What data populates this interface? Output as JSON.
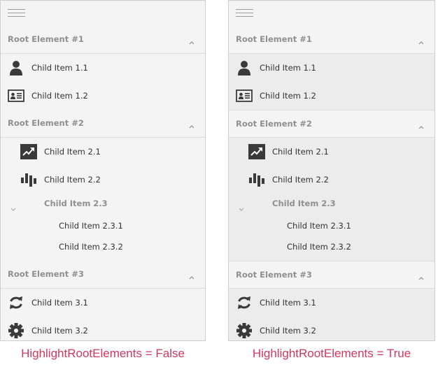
{
  "colors": {
    "panel_bg": "#f4f4f4",
    "highlight_bg": "#ececec",
    "root_text": "#8f8f8f",
    "item_text": "#333333",
    "icon": "#3a3a3a",
    "caption": "#d2385f"
  },
  "panels": [
    {
      "caption": "HighlightRootElements = False",
      "highlight_root_elements": false,
      "roots": [
        {
          "label": "Root Element #1",
          "expanded": true,
          "children": [
            {
              "label": "Child Item 1.1",
              "icon": "user-icon"
            },
            {
              "label": "Child Item 1.2",
              "icon": "id-card-icon"
            }
          ]
        },
        {
          "label": "Root Element #2",
          "expanded": true,
          "children": [
            {
              "label": "Child Item 2.1",
              "icon": "trending-up-icon"
            },
            {
              "label": "Child Item 2.2",
              "icon": "candlestick-icon"
            },
            {
              "label": "Child Item 2.3",
              "expanded": true,
              "children": [
                {
                  "label": "Child Item 2.3.1"
                },
                {
                  "label": "Child Item 2.3.2"
                }
              ]
            }
          ]
        },
        {
          "label": "Root Element #3",
          "expanded": true,
          "children": [
            {
              "label": "Child Item 3.1",
              "icon": "refresh-icon"
            },
            {
              "label": "Child Item 3.2",
              "icon": "gear-icon"
            }
          ]
        }
      ]
    },
    {
      "caption": "HighlightRootElements = True",
      "highlight_root_elements": true,
      "roots": [
        {
          "label": "Root Element #1",
          "expanded": true,
          "children": [
            {
              "label": "Child Item 1.1",
              "icon": "user-icon"
            },
            {
              "label": "Child Item 1.2",
              "icon": "id-card-icon"
            }
          ]
        },
        {
          "label": "Root Element #2",
          "expanded": true,
          "children": [
            {
              "label": "Child Item 2.1",
              "icon": "trending-up-icon"
            },
            {
              "label": "Child Item 2.2",
              "icon": "candlestick-icon"
            },
            {
              "label": "Child Item 2.3",
              "expanded": true,
              "children": [
                {
                  "label": "Child Item 2.3.1"
                },
                {
                  "label": "Child Item 2.3.2"
                }
              ]
            }
          ]
        },
        {
          "label": "Root Element #3",
          "expanded": true,
          "children": [
            {
              "label": "Child Item 3.1",
              "icon": "refresh-icon"
            },
            {
              "label": "Child Item 3.2",
              "icon": "gear-icon"
            }
          ]
        }
      ]
    }
  ]
}
